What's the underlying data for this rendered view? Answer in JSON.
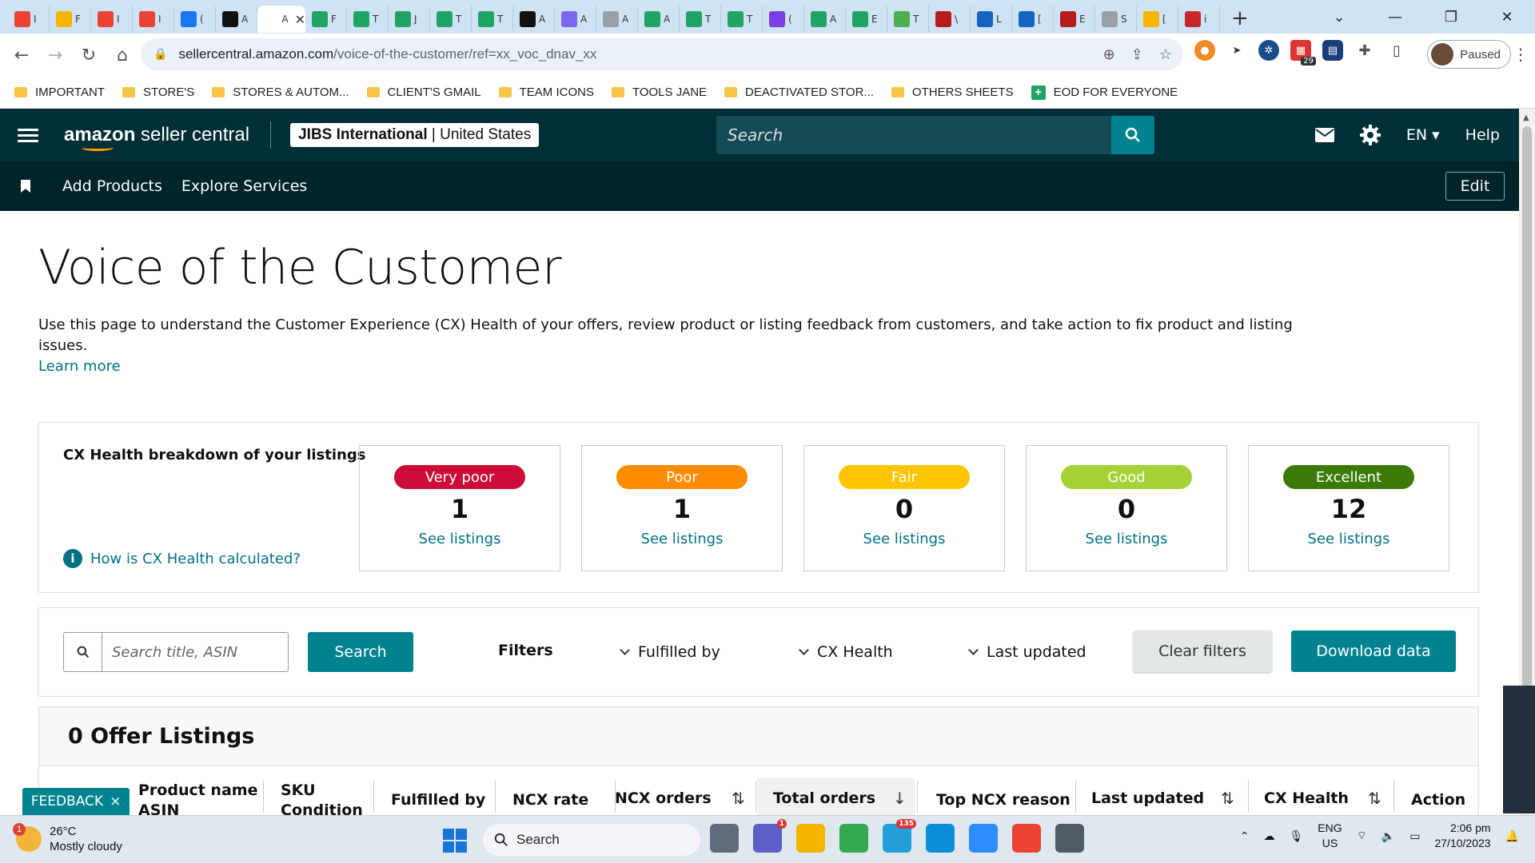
{
  "browser": {
    "tabs": [
      {
        "icon": "gmail-icon",
        "label": "I",
        "color": "#ea4335"
      },
      {
        "icon": "drive-icon",
        "label": "F",
        "color": "#f4b400"
      },
      {
        "icon": "gmail-icon",
        "label": "I",
        "color": "#ea4335"
      },
      {
        "icon": "gmail-icon",
        "label": "I",
        "color": "#ea4335"
      },
      {
        "icon": "facebook-icon",
        "label": "(",
        "color": "#1877f2"
      },
      {
        "icon": "amazon-icon",
        "label": "A",
        "color": "#111111"
      },
      {
        "icon": "seller-central-icon",
        "label": "A",
        "color": "#ffffff",
        "active": true
      },
      {
        "icon": "sheets-icon",
        "label": "F",
        "color": "#1fa463"
      },
      {
        "icon": "sheets-icon",
        "label": "T",
        "color": "#1fa463"
      },
      {
        "icon": "sheets-icon",
        "label": "J",
        "color": "#1fa463"
      },
      {
        "icon": "sheets-icon",
        "label": "T",
        "color": "#1fa463"
      },
      {
        "icon": "sheets-icon",
        "label": "T",
        "color": "#1fa463"
      },
      {
        "icon": "threads-icon",
        "label": "A",
        "color": "#111111"
      },
      {
        "icon": "clickup-icon",
        "label": "A",
        "color": "#7b68ee"
      },
      {
        "icon": "globe-icon",
        "label": "A",
        "color": "#9aa0a6"
      },
      {
        "icon": "sheets-icon",
        "label": "A",
        "color": "#1fa463"
      },
      {
        "icon": "sheets-icon",
        "label": "T",
        "color": "#1fa463"
      },
      {
        "icon": "sheets-icon",
        "label": "T",
        "color": "#1fa463"
      },
      {
        "icon": "messenger-icon",
        "label": "(",
        "color": "#7b3fe4"
      },
      {
        "icon": "sheets-icon",
        "label": "A",
        "color": "#1fa463"
      },
      {
        "icon": "sheets-icon",
        "label": "E",
        "color": "#1fa463"
      },
      {
        "icon": "w-green-icon",
        "label": "T",
        "color": "#4caf50"
      },
      {
        "icon": "w-red-icon",
        "label": "\\",
        "color": "#b71c1c"
      },
      {
        "icon": "cloud-icon",
        "label": "L",
        "color": "#1565c0"
      },
      {
        "icon": "bird-icon",
        "label": "[",
        "color": "#1565c0"
      },
      {
        "icon": "deer-icon",
        "label": "E",
        "color": "#b71c1c"
      },
      {
        "icon": "globe-icon",
        "label": "S",
        "color": "#9aa0a6"
      },
      {
        "icon": "smiley-icon",
        "label": "[",
        "color": "#f4b400"
      },
      {
        "icon": "shield-icon",
        "label": "i",
        "color": "#c62828"
      }
    ],
    "url_host": "sellercentral.amazon.com",
    "url_path": "/voice-of-the-customer/ref=xx_voc_dnav_xx",
    "profile_status": "Paused",
    "ext_badge": "29",
    "bookmarks": [
      {
        "label": "IMPORTANT",
        "type": "folder"
      },
      {
        "label": "STORE'S",
        "type": "folder"
      },
      {
        "label": "STORES & AUTOM...",
        "type": "folder"
      },
      {
        "label": "CLIENT'S GMAIL",
        "type": "folder"
      },
      {
        "label": "TEAM ICONS",
        "type": "folder"
      },
      {
        "label": "TOOLS JANE",
        "type": "folder"
      },
      {
        "label": "DEACTIVATED STOR...",
        "type": "folder"
      },
      {
        "label": "OTHERS SHEETS",
        "type": "folder"
      },
      {
        "label": "EOD FOR EVERYONE",
        "type": "sheets"
      }
    ]
  },
  "header": {
    "logo_bold": "amazon",
    "logo_rest": " seller central",
    "store_name": "JIBS International",
    "store_country": "United States",
    "search_placeholder": "Search",
    "language": "EN",
    "help": "Help"
  },
  "nav": {
    "links": [
      "Add Products",
      "Explore Services"
    ],
    "edit": "Edit"
  },
  "page": {
    "title": "Voice of the Customer",
    "description": "Use this page to understand the Customer Experience (CX) Health of your offers, review product or listing feedback from customers, and take action to fix product and listing issues.",
    "learn_more": "Learn more"
  },
  "cx": {
    "title": "CX Health breakdown of your listings",
    "help_link": "How is CX Health calculated?",
    "cards": [
      {
        "label": "Very poor",
        "count": "1",
        "link": "See listings",
        "color": "#cc0c39"
      },
      {
        "label": "Poor",
        "count": "1",
        "link": "See listings",
        "color": "#ff8c00"
      },
      {
        "label": "Fair",
        "count": "0",
        "link": "See listings",
        "color": "#ffc400"
      },
      {
        "label": "Good",
        "count": "0",
        "link": "See listings",
        "color": "#a4d236"
      },
      {
        "label": "Excellent",
        "count": "12",
        "link": "See listings",
        "color": "#3c7a08"
      }
    ]
  },
  "filters": {
    "search_placeholder": "Search title, ASIN",
    "search_button": "Search",
    "label": "Filters",
    "dropdowns": [
      "Fulfilled by",
      "CX Health",
      "Last updated"
    ],
    "clear": "Clear filters",
    "download": "Download data"
  },
  "listings": {
    "heading": "0 Offer Listings",
    "columns": [
      {
        "line1": "Product name",
        "line2": "ASIN"
      },
      {
        "line1": "SKU",
        "line2": "Condition"
      },
      {
        "line1": "Fulfilled by",
        "line2": ""
      },
      {
        "line1": "NCX rate",
        "line2": ""
      },
      {
        "line1": "NCX orders",
        "line2": ""
      },
      {
        "line1": "Total orders",
        "line2": ""
      },
      {
        "line1": "Top NCX reason",
        "line2": ""
      },
      {
        "line1": "Last updated",
        "line2": ""
      },
      {
        "line1": "CX Health",
        "line2": ""
      },
      {
        "line1": "Action",
        "line2": ""
      }
    ]
  },
  "feedback": {
    "label": "FEEDBACK",
    "close": "×"
  },
  "taskbar": {
    "weather_temp": "26°C",
    "weather_desc": "Mostly cloudy",
    "weather_badge": "1",
    "search": "Search",
    "apps": [
      {
        "icon": "task-view-icon",
        "color": "#5f6b78"
      },
      {
        "icon": "teams-icon",
        "color": "#5b5fc7",
        "badge": "1"
      },
      {
        "icon": "file-explorer-icon",
        "color": "#f4b400"
      },
      {
        "icon": "chrome-icon",
        "color": "#34a853"
      },
      {
        "icon": "telegram-icon",
        "color": "#229ed9",
        "badge": "135"
      },
      {
        "icon": "edge-icon",
        "color": "#0c8ed9"
      },
      {
        "icon": "zoom-icon",
        "color": "#2d8cff"
      },
      {
        "icon": "chrome-profile-icon",
        "color": "#ea4335"
      },
      {
        "icon": "calculator-icon",
        "color": "#4f5b66"
      }
    ],
    "lang_top": "ENG",
    "lang_bottom": "US",
    "time": "2:06 pm",
    "date": "27/10/2023"
  }
}
